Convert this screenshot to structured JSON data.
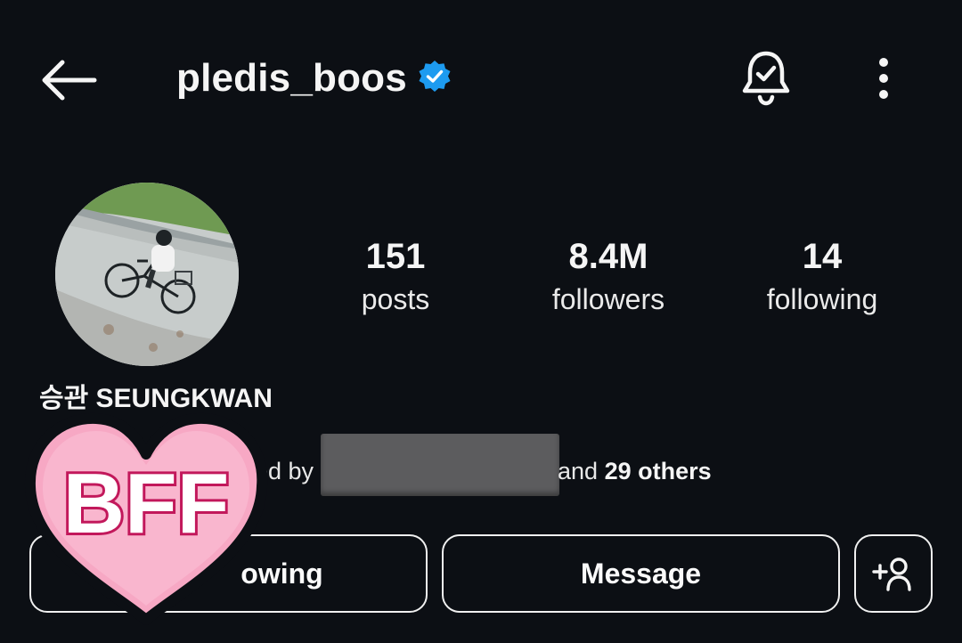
{
  "header": {
    "back_icon": "arrow-left-icon",
    "username": "pledis_boos",
    "verified_icon": "verified-badge-icon",
    "verified_color": "#1d9bf0",
    "bell_icon": "bell-check-icon",
    "more_icon": "more-vertical-icon"
  },
  "profile": {
    "display_name": "승관 SEUNGKWAN",
    "stats": [
      {
        "value": "151",
        "label": "posts"
      },
      {
        "value": "8.4M",
        "label": "followers"
      },
      {
        "value": "14",
        "label": "following"
      }
    ],
    "followed_by_prefix": "ed by",
    "followed_by_suffix_and": "and",
    "followed_by_count": "29 others"
  },
  "actions": {
    "following_label": "owing",
    "message_label": "Message",
    "add_friend_icon": "add-person-icon"
  },
  "sticker": {
    "text": "BFF",
    "fill_color": "#f7a8c4",
    "outline_color": "#0c0f14"
  },
  "colors": {
    "background": "#0c0f14",
    "text": "#f5f5f5"
  }
}
